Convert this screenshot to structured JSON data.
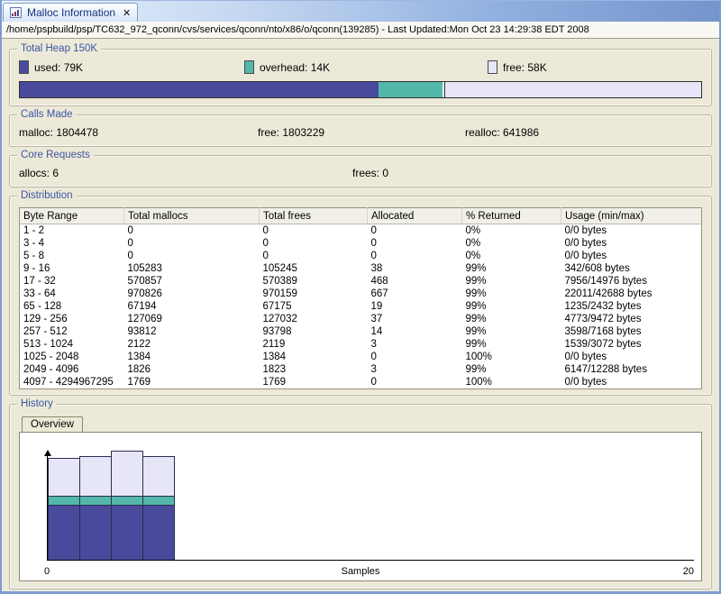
{
  "view": {
    "tab": {
      "title": "Malloc Information",
      "close_glyph": "✕"
    },
    "path_bar": "/home/pspbuild/psp/TC632_972_qconn/cvs/services/qconn/nto/x86/o/qconn(139285)  - Last Updated:Mon Oct 23 14:29:38 EDT 2008"
  },
  "heap": {
    "title": "Total Heap 150K",
    "total_k": 150,
    "legend": [
      {
        "name": "used",
        "label": "used: 79K",
        "value_k": 79,
        "color": "#4a4a9c"
      },
      {
        "name": "overhead",
        "label": "overhead: 14K",
        "value_k": 14,
        "color": "#53b8aa"
      },
      {
        "name": "free",
        "label": "free: 58K",
        "value_k": 58,
        "color": "#e6e6f8"
      }
    ]
  },
  "calls_made": {
    "title": "Calls Made",
    "malloc": "malloc: 1804478",
    "free": "free: 1803229",
    "realloc": "realloc: 641986"
  },
  "core_requests": {
    "title": "Core Requests",
    "allocs": "allocs: 6",
    "frees": "frees: 0"
  },
  "distribution": {
    "title": "Distribution",
    "columns": [
      "Byte Range",
      "Total mallocs",
      "Total frees",
      "Allocated",
      "% Returned",
      "Usage (min/max)"
    ],
    "rows": [
      [
        "1 - 2",
        "0",
        "0",
        "0",
        "0%",
        "0/0 bytes"
      ],
      [
        "3 - 4",
        "0",
        "0",
        "0",
        "0%",
        "0/0 bytes"
      ],
      [
        "5 - 8",
        "0",
        "0",
        "0",
        "0%",
        "0/0 bytes"
      ],
      [
        "9 - 16",
        "105283",
        "105245",
        "38",
        "99%",
        "342/608 bytes"
      ],
      [
        "17 - 32",
        "570857",
        "570389",
        "468",
        "99%",
        "7956/14976 bytes"
      ],
      [
        "33 - 64",
        "970826",
        "970159",
        "667",
        "99%",
        "22011/42688 bytes"
      ],
      [
        "65 - 128",
        "67194",
        "67175",
        "19",
        "99%",
        "1235/2432 bytes"
      ],
      [
        "129 - 256",
        "127069",
        "127032",
        "37",
        "99%",
        "4773/9472 bytes"
      ],
      [
        "257 - 512",
        "93812",
        "93798",
        "14",
        "99%",
        "3598/7168 bytes"
      ],
      [
        "513 - 1024",
        "2122",
        "2119",
        "3",
        "99%",
        "1539/3072 bytes"
      ],
      [
        "1025 - 2048",
        "1384",
        "1384",
        "0",
        "100%",
        "0/0 bytes"
      ],
      [
        "2049 - 4096",
        "1826",
        "1823",
        "3",
        "99%",
        "6147/12288 bytes"
      ],
      [
        "4097 - 4294967295",
        "1769",
        "1769",
        "0",
        "100%",
        "0/0 bytes"
      ]
    ]
  },
  "history": {
    "title": "History",
    "tab": "Overview",
    "chart_data": {
      "type": "stacked-bar",
      "xlabel": "Samples",
      "x_start": "0",
      "x_end": "20",
      "stack_order_bottom_to_top": [
        "used",
        "overhead",
        "free"
      ],
      "colors": {
        "used": "#4a4a9c",
        "overhead": "#53b8aa",
        "free": "#e6e6f8"
      },
      "samples_k": [
        {
          "used": 79,
          "overhead": 14,
          "free": 54
        },
        {
          "used": 79,
          "overhead": 14,
          "free": 56
        },
        {
          "used": 79,
          "overhead": 15,
          "free": 64
        },
        {
          "used": 79,
          "overhead": 14,
          "free": 57
        }
      ]
    }
  }
}
